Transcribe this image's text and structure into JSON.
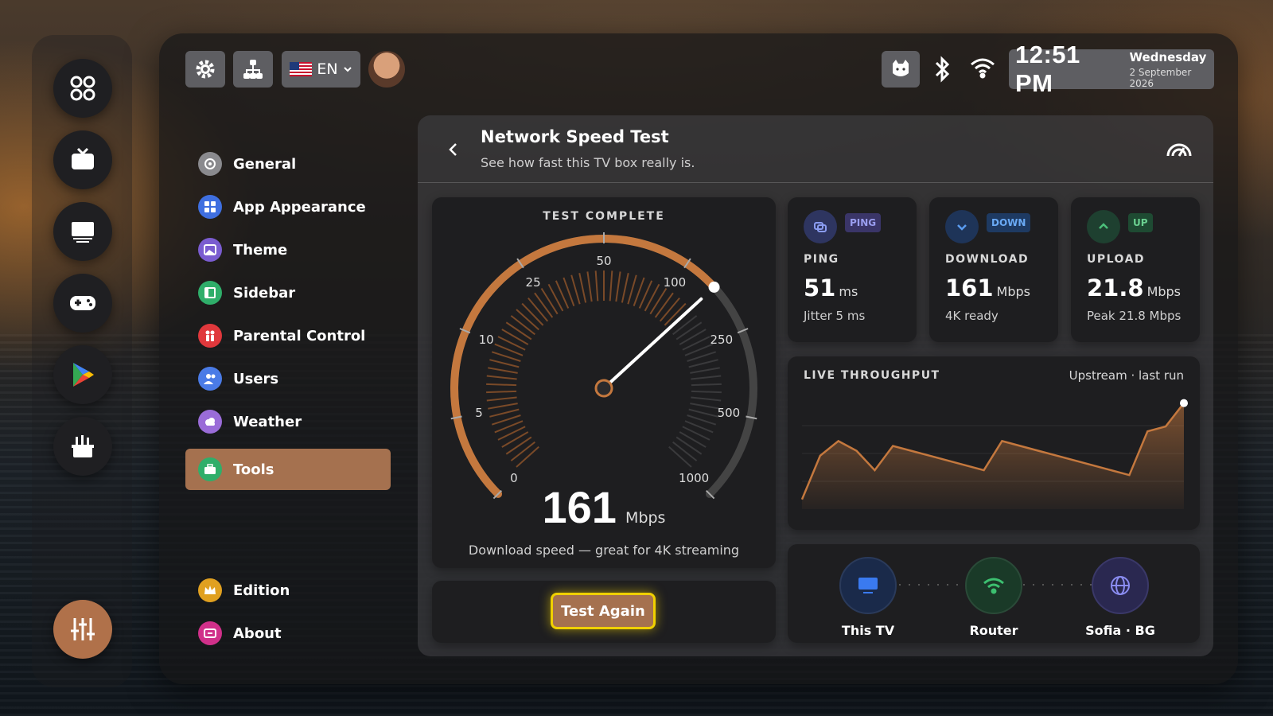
{
  "topbar": {
    "language": "EN",
    "time": "12:51 PM",
    "weekday": "Wednesday",
    "date": "2 September 2026"
  },
  "menu": {
    "items": [
      {
        "label": "General",
        "icon": "gear-icon",
        "color": "#8a8a8e"
      },
      {
        "label": "App Appearance",
        "icon": "grid-icon",
        "color": "#3f6fe0"
      },
      {
        "label": "Theme",
        "icon": "image-icon",
        "color": "#7a5cd0"
      },
      {
        "label": "Sidebar",
        "icon": "sidebar-icon",
        "color": "#2fae6a"
      },
      {
        "label": "Parental Control",
        "icon": "family-icon",
        "color": "#e0383c"
      },
      {
        "label": "Users",
        "icon": "users-icon",
        "color": "#4a7be6"
      },
      {
        "label": "Weather",
        "icon": "cloud-icon",
        "color": "#9a6cd8"
      },
      {
        "label": "Tools",
        "icon": "toolbox-icon",
        "color": "#2fae6a"
      },
      {
        "label": "Edition",
        "icon": "crown-icon",
        "color": "#e0a020"
      },
      {
        "label": "About",
        "icon": "info-icon",
        "color": "#d0308a"
      }
    ]
  },
  "header": {
    "title": "Network Speed Test",
    "subtitle": "See how fast this TV box really is."
  },
  "gauge": {
    "status": "TEST COMPLETE",
    "value": "161",
    "unit": "Mbps",
    "caption": "Download speed — great for 4K streaming",
    "reading": 161,
    "ticks": [
      "0",
      "5",
      "10",
      "25",
      "50",
      "100",
      "250",
      "500",
      "1000"
    ]
  },
  "stats": {
    "ping": {
      "badge": "PING",
      "label": "PING",
      "value": "51",
      "unit": "ms",
      "sub": "Jitter 5 ms"
    },
    "download": {
      "badge": "DOWN",
      "label": "DOWNLOAD",
      "value": "161",
      "unit": "Mbps",
      "sub": "4K ready"
    },
    "upload": {
      "badge": "UP",
      "label": "UPLOAD",
      "value": "21.8",
      "unit": "Mbps",
      "sub": "Peak 21.8 Mbps"
    }
  },
  "throughput": {
    "title": "LIVE THROUGHPUT",
    "meta": "Upstream · last run"
  },
  "test_button": "Test Again",
  "nodes": {
    "tv": "This TV",
    "router": "Router",
    "server": "Sofia · BG"
  },
  "colors": {
    "accent": "#a5714f",
    "arc": "#c4783e",
    "focus": "#f0d000"
  },
  "chart_data": {
    "type": "area",
    "title": "",
    "values": [
      2,
      11,
      14,
      12,
      8,
      13,
      12,
      11,
      10,
      9,
      8,
      14,
      13,
      12,
      11,
      10,
      9,
      8,
      7,
      16,
      17,
      21.8
    ]
  }
}
